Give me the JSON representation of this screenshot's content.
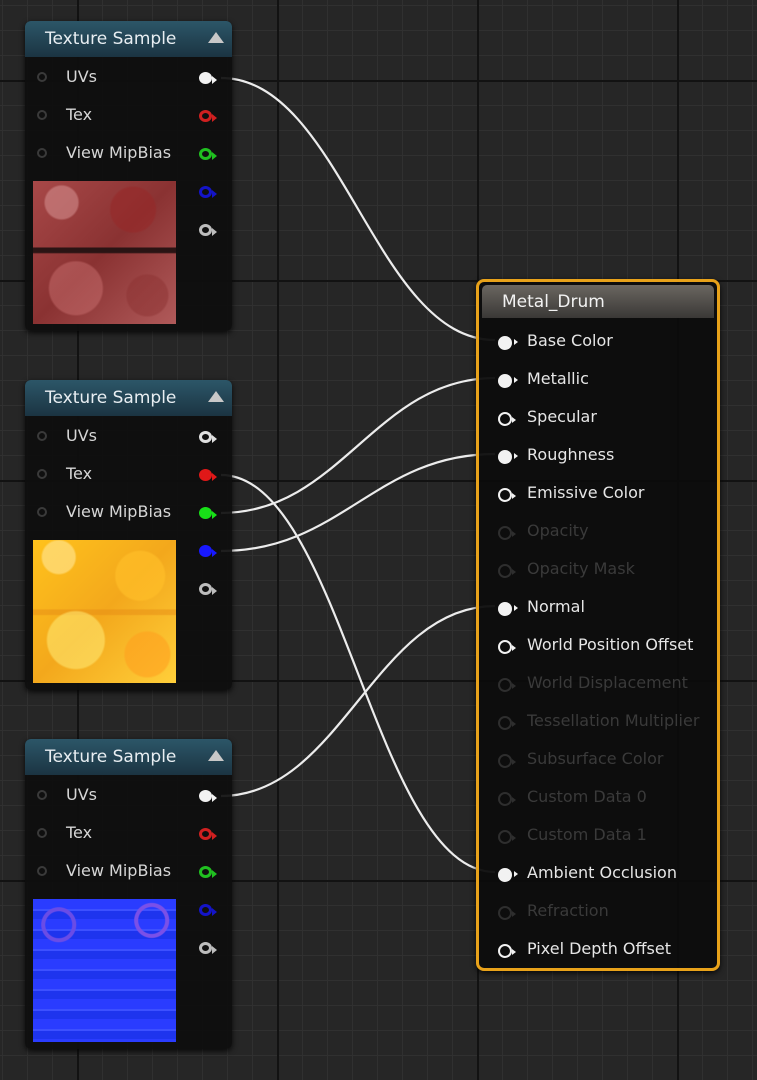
{
  "texture_nodes": [
    {
      "title": "Texture Sample",
      "thumbnail": "red-metal-texture",
      "pins": [
        {
          "label": "UVs",
          "out_color": "#f2f2f2",
          "filled": true
        },
        {
          "label": "Tex",
          "out_color": "#d02020",
          "filled": false
        },
        {
          "label": "View MipBias",
          "out_color": "#20c020",
          "filled": false
        }
      ],
      "extra_pins": [
        {
          "out_color": "#1414c8",
          "filled": false
        },
        {
          "out_color": "#bdbdbd",
          "filled": false
        }
      ]
    },
    {
      "title": "Texture Sample",
      "thumbnail": "yellow-roughness-texture",
      "pins": [
        {
          "label": "UVs",
          "out_color": "#e0e0e0",
          "filled": false
        },
        {
          "label": "Tex",
          "out_color": "#e01818",
          "filled": true
        },
        {
          "label": "View MipBias",
          "out_color": "#18e018",
          "filled": true
        }
      ],
      "extra_pins": [
        {
          "out_color": "#1818ff",
          "filled": true
        },
        {
          "out_color": "#bdbdbd",
          "filled": false
        }
      ]
    },
    {
      "title": "Texture Sample",
      "thumbnail": "blue-normal-map-texture",
      "pins": [
        {
          "label": "UVs",
          "out_color": "#f2f2f2",
          "filled": true
        },
        {
          "label": "Tex",
          "out_color": "#d02020",
          "filled": false
        },
        {
          "label": "View MipBias",
          "out_color": "#20c020",
          "filled": false
        }
      ],
      "extra_pins": [
        {
          "out_color": "#1414c8",
          "filled": false
        },
        {
          "out_color": "#bdbdbd",
          "filled": false
        }
      ]
    }
  ],
  "material_node": {
    "title": "Metal_Drum",
    "accent_color": "#e8a21a",
    "inputs": [
      {
        "label": "Base Color",
        "state": "filled"
      },
      {
        "label": "Metallic",
        "state": "filled"
      },
      {
        "label": "Specular",
        "state": "hollow"
      },
      {
        "label": "Roughness",
        "state": "filled"
      },
      {
        "label": "Emissive Color",
        "state": "hollow"
      },
      {
        "label": "Opacity",
        "state": "disabled"
      },
      {
        "label": "Opacity Mask",
        "state": "disabled"
      },
      {
        "label": "Normal",
        "state": "filled"
      },
      {
        "label": "World Position Offset",
        "state": "hollow"
      },
      {
        "label": "World Displacement",
        "state": "disabled"
      },
      {
        "label": "Tessellation Multiplier",
        "state": "disabled"
      },
      {
        "label": "Subsurface Color",
        "state": "disabled"
      },
      {
        "label": "Custom Data 0",
        "state": "disabled"
      },
      {
        "label": "Custom Data 1",
        "state": "disabled"
      },
      {
        "label": "Ambient Occlusion",
        "state": "filled"
      },
      {
        "label": "Refraction",
        "state": "disabled"
      },
      {
        "label": "Pixel Depth Offset",
        "state": "hollow"
      }
    ]
  },
  "connections": [
    {
      "from_node": 0,
      "from_pin": "UVs",
      "to_input": "Base Color"
    },
    {
      "from_node": 1,
      "from_pin": "View MipBias",
      "to_input": "Metallic"
    },
    {
      "from_node": 1,
      "from_pin": "Blue",
      "to_input": "Roughness"
    },
    {
      "from_node": 1,
      "from_pin": "Tex",
      "to_input": "Ambient Occlusion"
    },
    {
      "from_node": 2,
      "from_pin": "UVs",
      "to_input": "Normal"
    }
  ]
}
